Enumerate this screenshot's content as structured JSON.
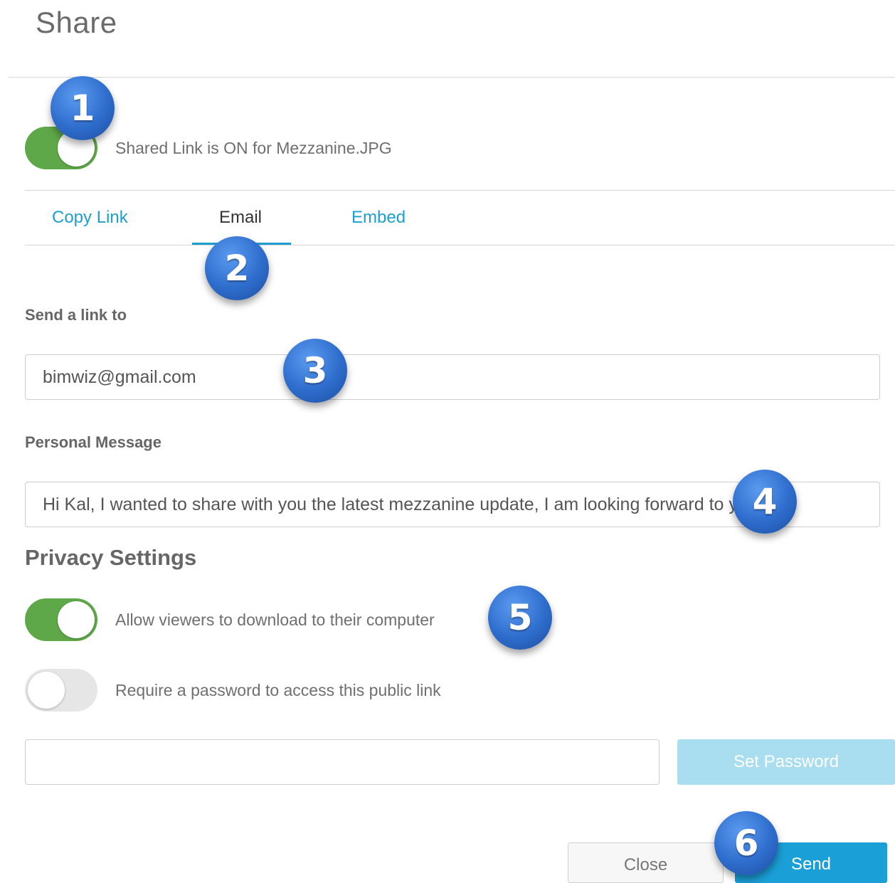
{
  "dialog": {
    "title": "Share"
  },
  "shared_link": {
    "label": "Shared Link is ON for Mezzanine.JPG",
    "enabled": true
  },
  "tabs": [
    {
      "label": "Copy Link",
      "active": false
    },
    {
      "label": "Email",
      "active": true
    },
    {
      "label": "Embed",
      "active": false
    }
  ],
  "email": {
    "recipient_label": "Send a link to",
    "recipient_value": "bimwiz@gmail.com",
    "message_label": "Personal Message",
    "message_value": "Hi Kal, I wanted to share with you the latest mezzanine update, I am looking forward to your c"
  },
  "privacy": {
    "title": "Privacy Settings",
    "allow_download": {
      "label": "Allow viewers to download to their computer",
      "enabled": true
    },
    "require_password": {
      "label": "Require a password to access this public link",
      "enabled": false
    },
    "password_value": "",
    "set_password_label": "Set Password"
  },
  "footer": {
    "close_label": "Close",
    "send_label": "Send"
  },
  "callouts": [
    "1",
    "2",
    "3",
    "4",
    "5",
    "6"
  ],
  "colors": {
    "accent": "#1a9fd6",
    "toggle_on": "#5fa84a",
    "toggle_off": "#e6e6e6",
    "callout": "#2e6ccc"
  }
}
